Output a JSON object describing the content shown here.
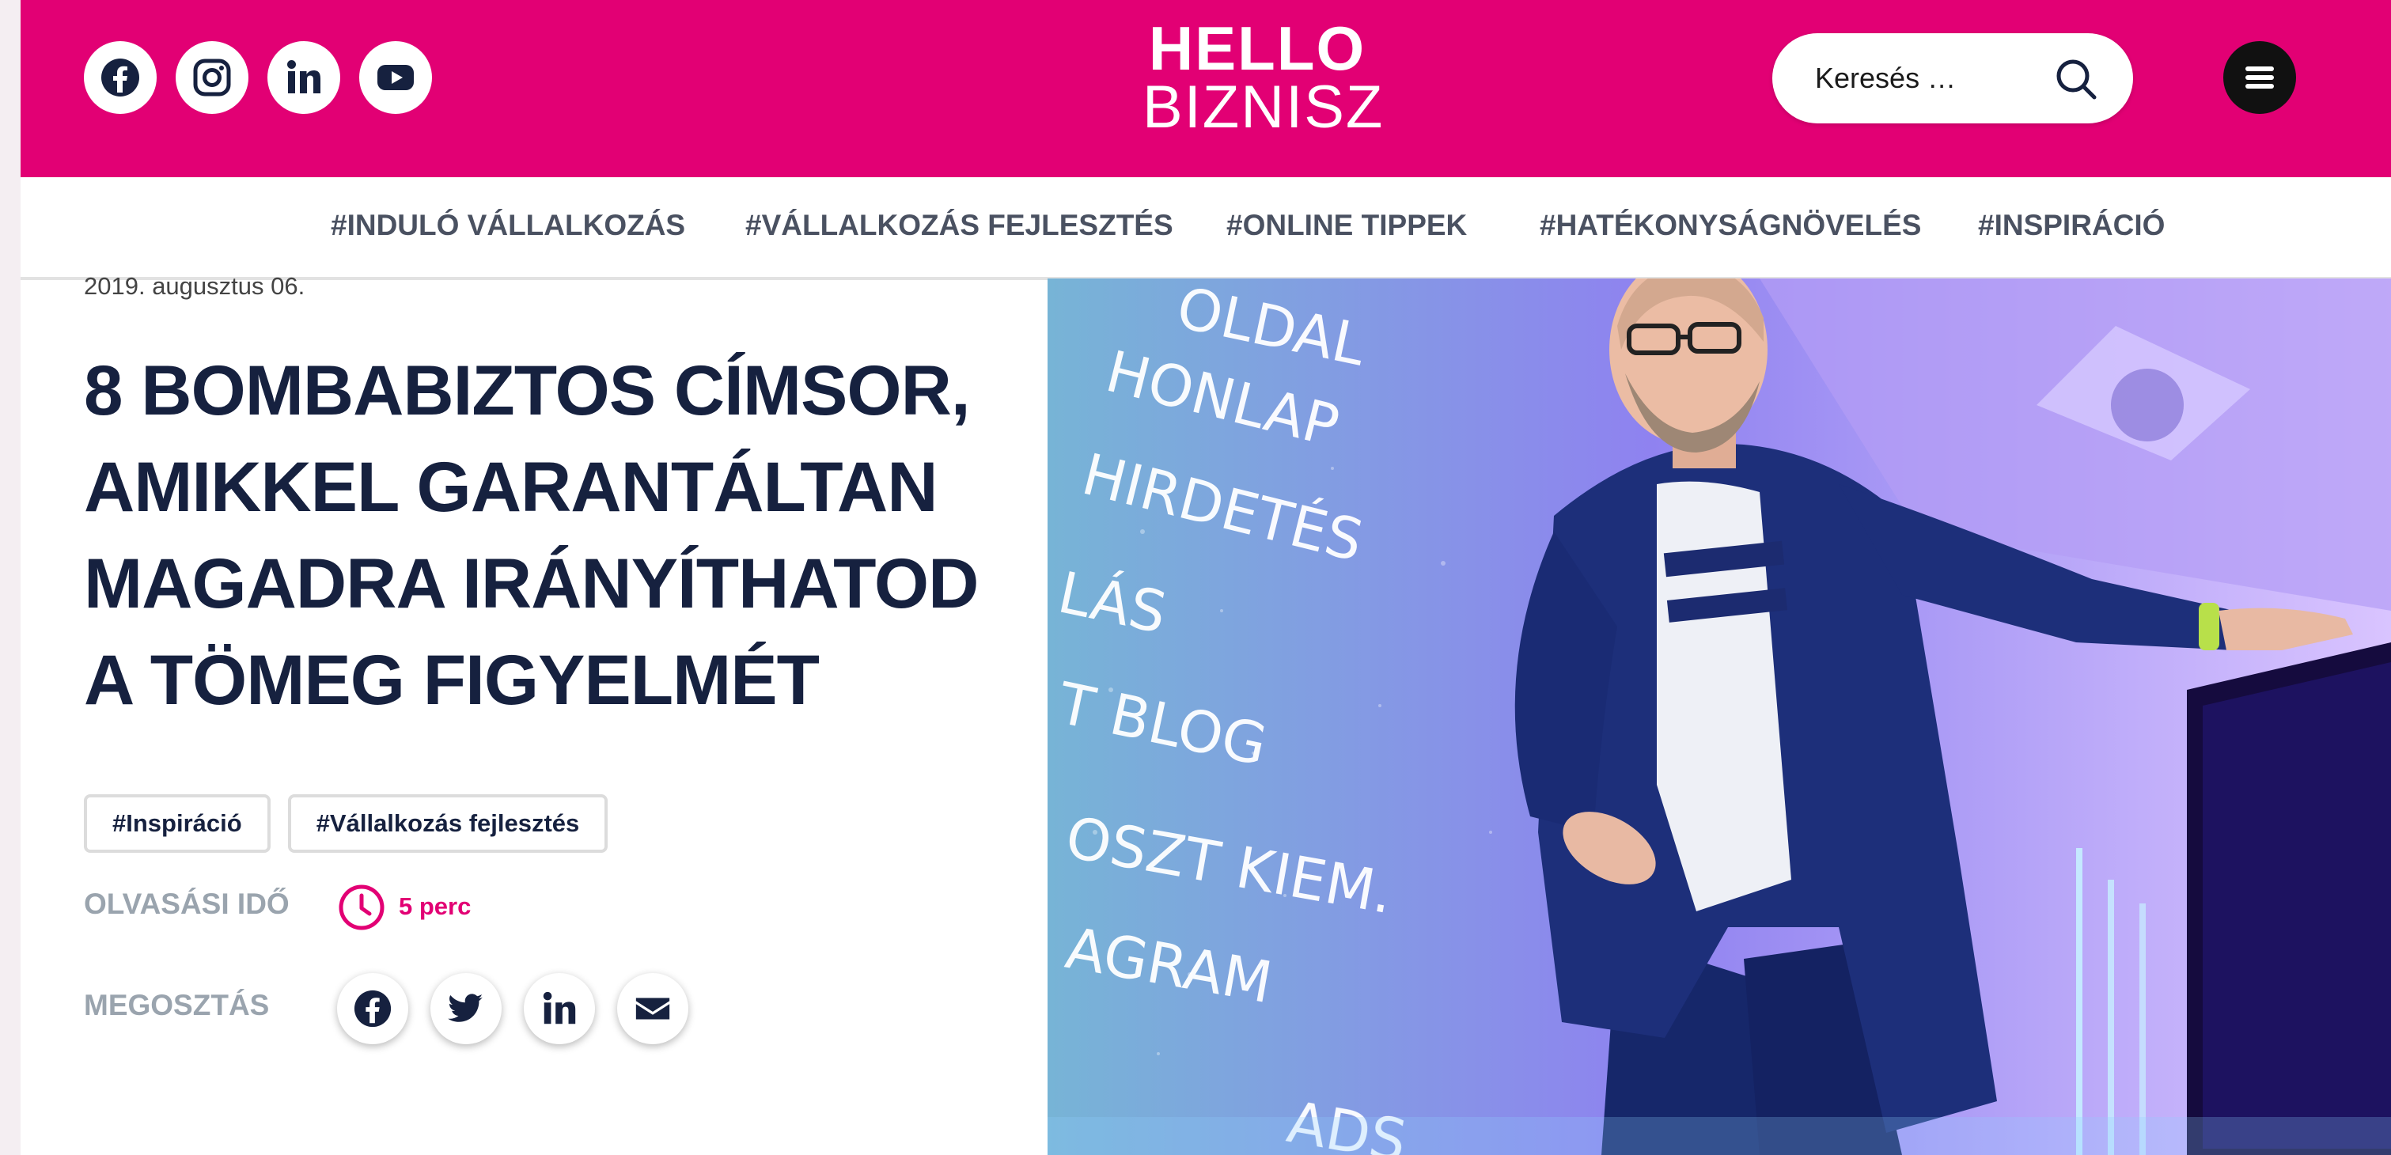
{
  "header": {
    "logo_line1": "HELLO",
    "logo_line2": "BIZNISZ",
    "search_placeholder": "Keresés …",
    "brand_color": "#e20074",
    "social_icons": [
      "facebook-icon",
      "instagram-icon",
      "linkedin-icon",
      "youtube-icon"
    ]
  },
  "nav": {
    "items": [
      "#INDULÓ VÁLLALKOZÁS",
      "#VÁLLALKOZÁS FEJLESZTÉS",
      "#ONLINE TIPPEK",
      "#HATÉKONYSÁGNÖVELÉS",
      "#INSPIRÁCIÓ"
    ]
  },
  "article": {
    "date": "2019. augusztus 06.",
    "title_lines": [
      "8 BOMBABIZTOS CÍMSOR,",
      "AMIKKEL GARANTÁLTAN",
      "MAGADRA IRÁNYÍTHATOD",
      "A TÖMEG FIGYELMÉT"
    ],
    "tags": [
      "#Inspiráció",
      "#Vállalkozás fejlesztés"
    ],
    "reading_time_label": "OLVASÁSI IDŐ",
    "reading_time_value": "5 perc",
    "share_label": "MEGOSZTÁS",
    "share_icons": [
      "facebook-icon",
      "twitter-icon",
      "linkedin-icon",
      "email-icon"
    ]
  },
  "hero": {
    "screen_words": [
      "OLDAL",
      "HONLAP",
      "HIRDETÉS",
      "LÁS",
      "T BLOG",
      "OSZT KIEM.",
      "AGRAM",
      "ADS"
    ]
  }
}
